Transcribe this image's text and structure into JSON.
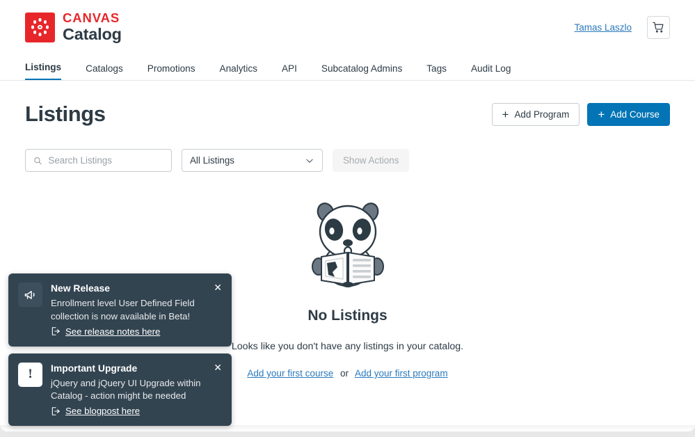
{
  "header": {
    "brand_primary": "CANVAS",
    "brand_secondary": "Catalog",
    "user_name": "Tamas Laszlo",
    "cart_icon": "shopping-cart-icon"
  },
  "nav": {
    "items": [
      {
        "label": "Listings",
        "active": true
      },
      {
        "label": "Catalogs",
        "active": false
      },
      {
        "label": "Promotions",
        "active": false
      },
      {
        "label": "Analytics",
        "active": false
      },
      {
        "label": "API",
        "active": false
      },
      {
        "label": "Subcatalog Admins",
        "active": false
      },
      {
        "label": "Tags",
        "active": false
      },
      {
        "label": "Audit Log",
        "active": false
      }
    ]
  },
  "page": {
    "title": "Listings",
    "add_program_label": "Add Program",
    "add_course_label": "Add Course",
    "plus_glyph": "+"
  },
  "filters": {
    "search_placeholder": "Search Listings",
    "search_value": "",
    "search_icon": "search-icon",
    "select_value": "All Listings",
    "select_icon": "chevron-down-icon",
    "show_actions_label": "Show Actions"
  },
  "empty_state": {
    "illustration": "panda-reading-newspaper",
    "title": "No Listings",
    "subtitle": "Looks like you don't have any listings in your catalog.",
    "link_course": "Add your first course",
    "or_text": "or",
    "link_program": "Add your first program"
  },
  "toasts": [
    {
      "icon": "megaphone-icon",
      "title": "New Release",
      "text": "Enrollment level User Defined Field collection is now available in Beta!",
      "link_label": "See release notes here",
      "link_icon": "external-link-icon",
      "close_glyph": "✕"
    },
    {
      "icon": "exclamation-icon",
      "icon_glyph": "!",
      "title": "Important Upgrade",
      "text": "jQuery and jQuery UI Upgrade within Catalog - action might be needed",
      "link_label": "See blogpost here",
      "link_icon": "external-link-icon",
      "close_glyph": "✕"
    }
  ],
  "colors": {
    "brand_red": "#E7262A",
    "canvas_blue": "#0374B5",
    "link_blue": "#2B7ABC",
    "dark_slate": "#2D3B45",
    "toast_bg": "#334451"
  }
}
